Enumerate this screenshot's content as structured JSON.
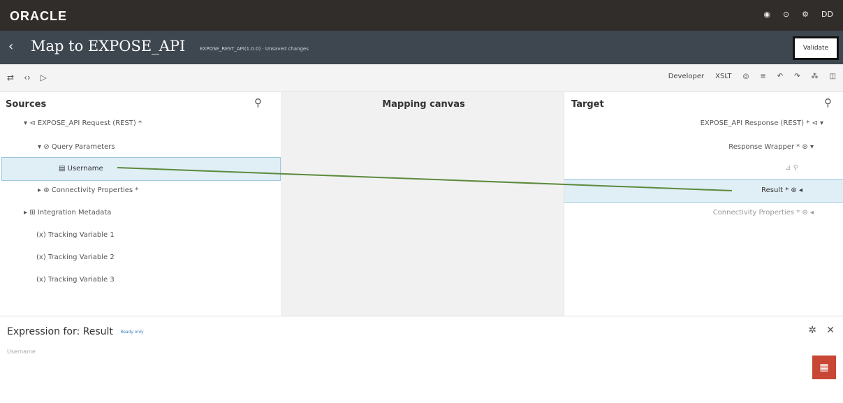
{
  "topbar": {
    "logo": "ORACLE",
    "icons": [
      "notification-icon",
      "help-icon",
      "settings-icon"
    ],
    "user": "DD"
  },
  "titlebar": {
    "back": "‹",
    "title": "Map to EXPOSE_API",
    "subtitle": "EXPOSE_REST_API(1.0.0) · Unsaved changes",
    "validate": "Validate"
  },
  "toolbar": {
    "left": [
      "⇄",
      "‹›",
      "▷"
    ],
    "mode": "Developer",
    "lang": "XSLT",
    "icons": [
      "◎",
      "≡",
      "↶",
      "↷",
      "⁂",
      "◫"
    ]
  },
  "sources": {
    "heading": "Sources",
    "rows": [
      "▾ ⊲ EXPOSE_API Request (REST) *",
      "▾ ⊘ Query Parameters",
      "▤ Username",
      "▸ ⊛ Connectivity Properties *",
      "▸ ⊞ Integration Metadata",
      "(x) Tracking Variable 1",
      "(x) Tracking Variable 2",
      "(x) Tracking Variable 3"
    ]
  },
  "canvas": {
    "heading": "Mapping canvas"
  },
  "target": {
    "heading": "Target",
    "rows": [
      "EXPOSE_API Response (REST) * ⊲ ▾",
      "Response Wrapper * ⊛ ▾",
      "⊿ ⚲",
      "Result * ⊛ ◂",
      "Connectivity Properties * ⊛ ◂"
    ]
  },
  "expression": {
    "label": "Expression for:",
    "target": "Result",
    "badge": "Ready only",
    "value": "Username",
    "pin": "✲",
    "close": "✕",
    "chat": "▦"
  },
  "colors": {
    "topbar": "#312d2a",
    "titlebar": "#3e4750",
    "mapping_line": "#5b8a3c",
    "chat": "#c74634"
  }
}
